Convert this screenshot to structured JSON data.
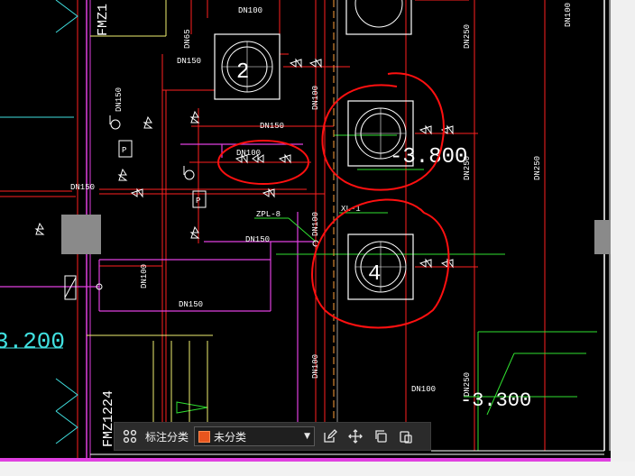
{
  "drawing": {
    "labels": {
      "fmz_top": "FMZ1",
      "fmz_bottom": "FMZ1224",
      "dn100_top": "DN100",
      "dn65": "DN65",
      "dn150_a": "DN150",
      "dn150_b": "DN150",
      "dn150_c": "DN150",
      "dn150_left": "DN150",
      "dn150_mid": "DN150",
      "dn150_low": "DN150",
      "dn100_valves": "DN100",
      "dn100_vert1": "DN100",
      "dn100_vert2": "DN100",
      "dn100_vert3": "DN100",
      "dn100_bottom": "DN100",
      "dn250_a": "DN250",
      "dn250_b": "DN250",
      "dn250_c": "DN250",
      "dn250_d": "DN250",
      "dn100_right": "DN100",
      "zpl": "ZPL-8",
      "xl": "XL-1",
      "elev_main": "-3.800",
      "elev_left": "3.200",
      "elev_bottom": "-3.300",
      "unit_mark_2": "2",
      "unit_mark_4": "4",
      "p_label": "P"
    },
    "colors": {
      "background": "#000000",
      "red_line": "#ff2020",
      "magenta_line": "#e040e0",
      "green_line": "#30e030",
      "yellow_line": "#f0f070",
      "cyan_line": "#40e0e0",
      "white_line": "#ffffff",
      "gray_fill": "#8a8a8a",
      "annotation": "#ff1010"
    }
  },
  "toolbar": {
    "grid_icon": "grid-icon",
    "category_label": "标注分类",
    "category_value": "未分类",
    "swatch_color": "#e8551e",
    "edit_icon": "edit-icon",
    "move_icon": "move-icon",
    "copy_icon": "copy-icon",
    "paste_icon": "paste-icon"
  }
}
